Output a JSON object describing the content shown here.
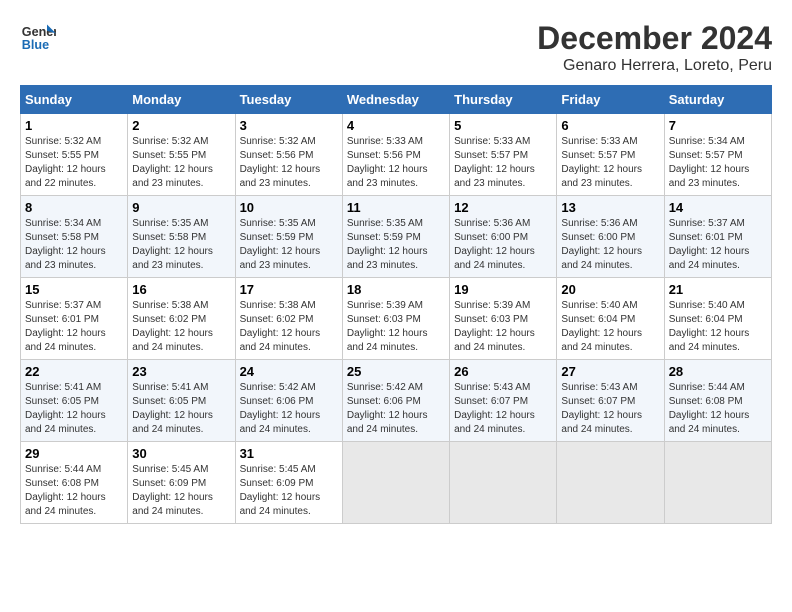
{
  "header": {
    "logo_line1": "General",
    "logo_line2": "Blue",
    "month": "December 2024",
    "location": "Genaro Herrera, Loreto, Peru"
  },
  "weekdays": [
    "Sunday",
    "Monday",
    "Tuesday",
    "Wednesday",
    "Thursday",
    "Friday",
    "Saturday"
  ],
  "weeks": [
    [
      {
        "day": "1",
        "info": "Sunrise: 5:32 AM\nSunset: 5:55 PM\nDaylight: 12 hours\nand 22 minutes."
      },
      {
        "day": "2",
        "info": "Sunrise: 5:32 AM\nSunset: 5:55 PM\nDaylight: 12 hours\nand 23 minutes."
      },
      {
        "day": "3",
        "info": "Sunrise: 5:32 AM\nSunset: 5:56 PM\nDaylight: 12 hours\nand 23 minutes."
      },
      {
        "day": "4",
        "info": "Sunrise: 5:33 AM\nSunset: 5:56 PM\nDaylight: 12 hours\nand 23 minutes."
      },
      {
        "day": "5",
        "info": "Sunrise: 5:33 AM\nSunset: 5:57 PM\nDaylight: 12 hours\nand 23 minutes."
      },
      {
        "day": "6",
        "info": "Sunrise: 5:33 AM\nSunset: 5:57 PM\nDaylight: 12 hours\nand 23 minutes."
      },
      {
        "day": "7",
        "info": "Sunrise: 5:34 AM\nSunset: 5:57 PM\nDaylight: 12 hours\nand 23 minutes."
      }
    ],
    [
      {
        "day": "8",
        "info": "Sunrise: 5:34 AM\nSunset: 5:58 PM\nDaylight: 12 hours\nand 23 minutes."
      },
      {
        "day": "9",
        "info": "Sunrise: 5:35 AM\nSunset: 5:58 PM\nDaylight: 12 hours\nand 23 minutes."
      },
      {
        "day": "10",
        "info": "Sunrise: 5:35 AM\nSunset: 5:59 PM\nDaylight: 12 hours\nand 23 minutes."
      },
      {
        "day": "11",
        "info": "Sunrise: 5:35 AM\nSunset: 5:59 PM\nDaylight: 12 hours\nand 23 minutes."
      },
      {
        "day": "12",
        "info": "Sunrise: 5:36 AM\nSunset: 6:00 PM\nDaylight: 12 hours\nand 24 minutes."
      },
      {
        "day": "13",
        "info": "Sunrise: 5:36 AM\nSunset: 6:00 PM\nDaylight: 12 hours\nand 24 minutes."
      },
      {
        "day": "14",
        "info": "Sunrise: 5:37 AM\nSunset: 6:01 PM\nDaylight: 12 hours\nand 24 minutes."
      }
    ],
    [
      {
        "day": "15",
        "info": "Sunrise: 5:37 AM\nSunset: 6:01 PM\nDaylight: 12 hours\nand 24 minutes."
      },
      {
        "day": "16",
        "info": "Sunrise: 5:38 AM\nSunset: 6:02 PM\nDaylight: 12 hours\nand 24 minutes."
      },
      {
        "day": "17",
        "info": "Sunrise: 5:38 AM\nSunset: 6:02 PM\nDaylight: 12 hours\nand 24 minutes."
      },
      {
        "day": "18",
        "info": "Sunrise: 5:39 AM\nSunset: 6:03 PM\nDaylight: 12 hours\nand 24 minutes."
      },
      {
        "day": "19",
        "info": "Sunrise: 5:39 AM\nSunset: 6:03 PM\nDaylight: 12 hours\nand 24 minutes."
      },
      {
        "day": "20",
        "info": "Sunrise: 5:40 AM\nSunset: 6:04 PM\nDaylight: 12 hours\nand 24 minutes."
      },
      {
        "day": "21",
        "info": "Sunrise: 5:40 AM\nSunset: 6:04 PM\nDaylight: 12 hours\nand 24 minutes."
      }
    ],
    [
      {
        "day": "22",
        "info": "Sunrise: 5:41 AM\nSunset: 6:05 PM\nDaylight: 12 hours\nand 24 minutes."
      },
      {
        "day": "23",
        "info": "Sunrise: 5:41 AM\nSunset: 6:05 PM\nDaylight: 12 hours\nand 24 minutes."
      },
      {
        "day": "24",
        "info": "Sunrise: 5:42 AM\nSunset: 6:06 PM\nDaylight: 12 hours\nand 24 minutes."
      },
      {
        "day": "25",
        "info": "Sunrise: 5:42 AM\nSunset: 6:06 PM\nDaylight: 12 hours\nand 24 minutes."
      },
      {
        "day": "26",
        "info": "Sunrise: 5:43 AM\nSunset: 6:07 PM\nDaylight: 12 hours\nand 24 minutes."
      },
      {
        "day": "27",
        "info": "Sunrise: 5:43 AM\nSunset: 6:07 PM\nDaylight: 12 hours\nand 24 minutes."
      },
      {
        "day": "28",
        "info": "Sunrise: 5:44 AM\nSunset: 6:08 PM\nDaylight: 12 hours\nand 24 minutes."
      }
    ],
    [
      {
        "day": "29",
        "info": "Sunrise: 5:44 AM\nSunset: 6:08 PM\nDaylight: 12 hours\nand 24 minutes."
      },
      {
        "day": "30",
        "info": "Sunrise: 5:45 AM\nSunset: 6:09 PM\nDaylight: 12 hours\nand 24 minutes."
      },
      {
        "day": "31",
        "info": "Sunrise: 5:45 AM\nSunset: 6:09 PM\nDaylight: 12 hours\nand 24 minutes."
      },
      {
        "day": "",
        "info": ""
      },
      {
        "day": "",
        "info": ""
      },
      {
        "day": "",
        "info": ""
      },
      {
        "day": "",
        "info": ""
      }
    ]
  ]
}
